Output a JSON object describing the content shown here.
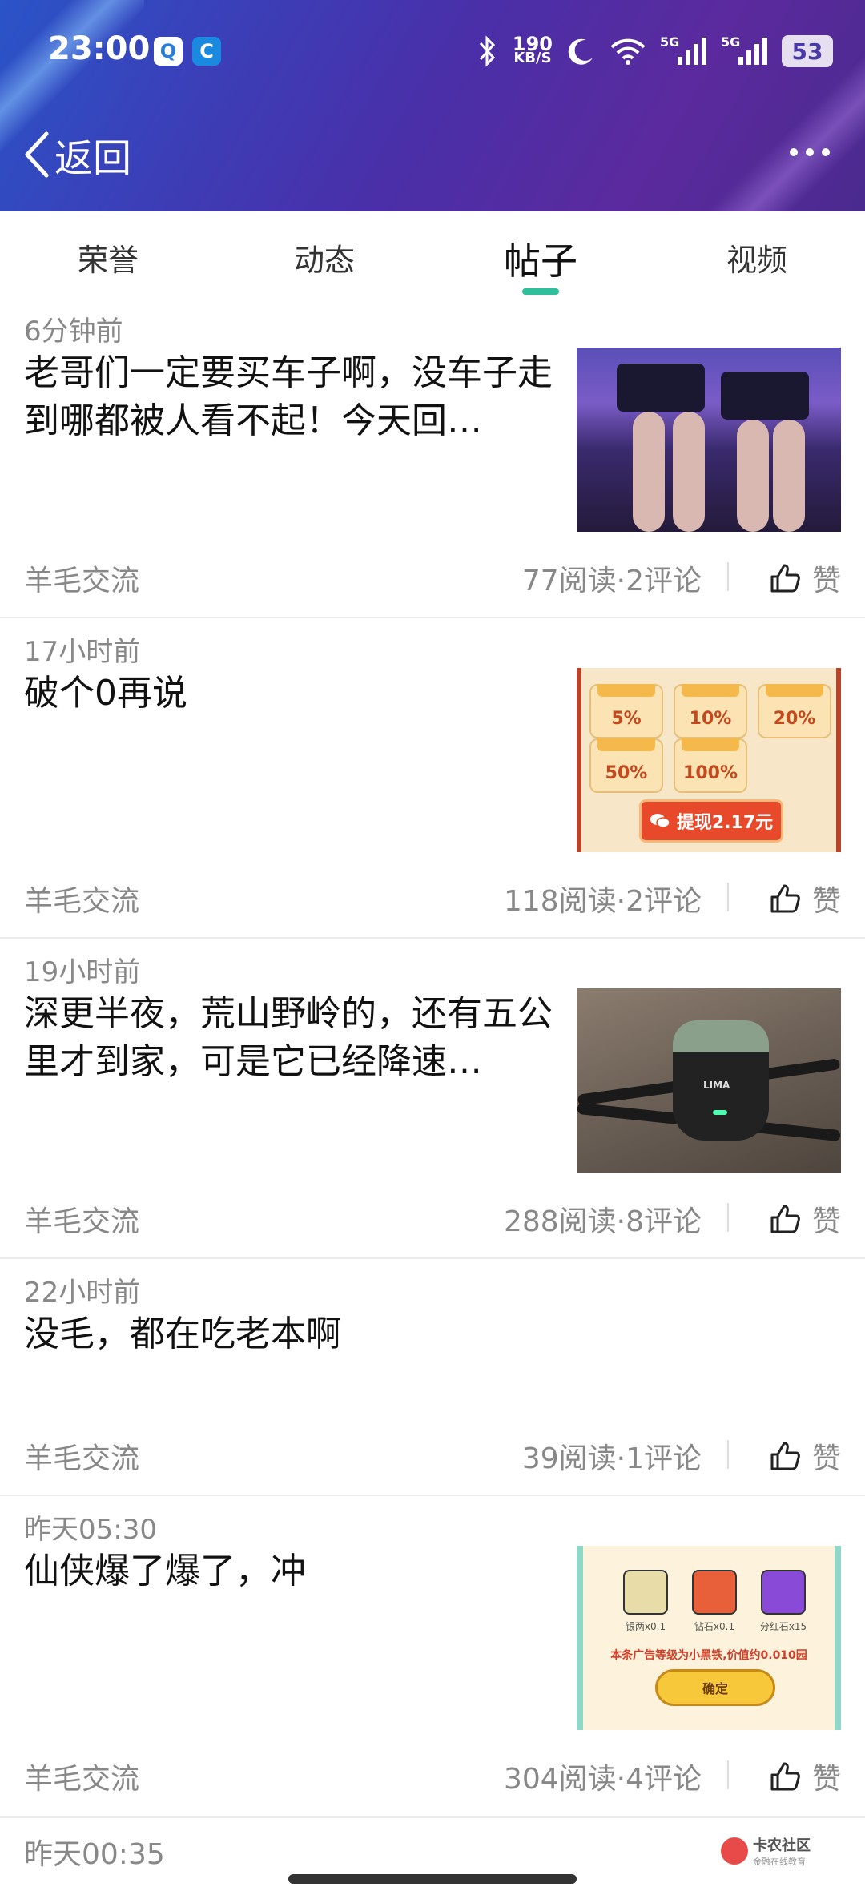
{
  "status_bar": {
    "time": "23:00",
    "speed_value": "190",
    "speed_unit": "KB/S",
    "signal1_label": "5G",
    "signal2_label": "5G",
    "battery": "53"
  },
  "nav": {
    "back_label": "返回"
  },
  "tabs": [
    {
      "label": "荣誉",
      "active": false
    },
    {
      "label": "动态",
      "active": false
    },
    {
      "label": "帖子",
      "active": true
    },
    {
      "label": "视频",
      "active": false
    }
  ],
  "posts": [
    {
      "time": "6分钟前",
      "title": "老哥们一定要买车子啊，没车子走到哪都被人看不起！今天回…",
      "category": "羊毛交流",
      "stats": "77阅读·2评论",
      "like_label": "赞"
    },
    {
      "time": "17小时前",
      "title": "破个0再说",
      "category": "羊毛交流",
      "stats": "118阅读·2评论",
      "like_label": "赞",
      "thumb": {
        "coupons": [
          "5%",
          "10%",
          "20%",
          "50%",
          "100%"
        ],
        "withdraw": "提现2.17元"
      }
    },
    {
      "time": "19小时前",
      "title": "深更半夜，荒山野岭的，还有五公里才到家，可是它已经降速…",
      "category": "羊毛交流",
      "stats": "288阅读·8评论",
      "like_label": "赞",
      "thumb": {
        "brand": "LIMA"
      }
    },
    {
      "time": "22小时前",
      "title": "没毛，都在吃老本啊",
      "category": "羊毛交流",
      "stats": "39阅读·1评论",
      "like_label": "赞"
    },
    {
      "time": "昨天05:30",
      "title": "仙侠爆了爆了，冲",
      "category": "羊毛交流",
      "stats": "304阅读·4评论",
      "like_label": "赞",
      "thumb": {
        "rewards": [
          "银两x0.1",
          "钻石x0.1",
          "分红石x15"
        ],
        "note": "本条广告等级为小黑铁,价值约0.010园",
        "confirm": "确定"
      }
    }
  ],
  "partial_post": {
    "time": "昨天00:35"
  },
  "watermark": {
    "title": "卡农社区",
    "subtitle": "金融在线教育"
  }
}
